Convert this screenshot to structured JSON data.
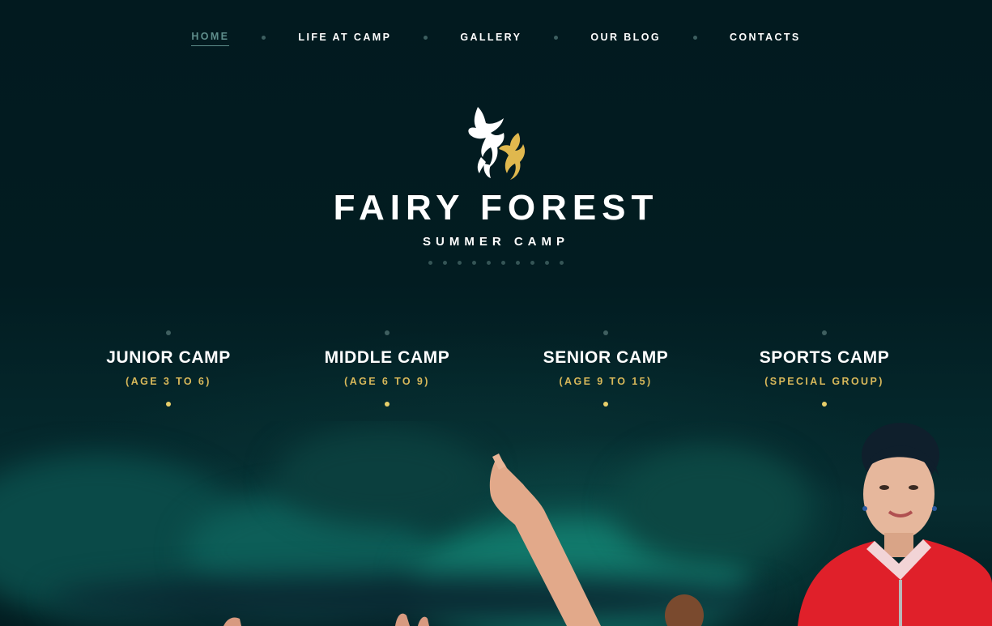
{
  "nav": {
    "items": [
      {
        "label": "HOME",
        "active": true
      },
      {
        "label": "LIFE AT CAMP",
        "active": false
      },
      {
        "label": "GALLERY",
        "active": false
      },
      {
        "label": "OUR BLOG",
        "active": false
      },
      {
        "label": "CONTACTS",
        "active": false
      }
    ]
  },
  "brand": {
    "title": "FAIRY FOREST",
    "subtitle": "SUMMER CAMP",
    "logo_icon": "phoenix-birds-icon"
  },
  "camps": [
    {
      "title": "JUNIOR CAMP",
      "age": "(AGE 3 TO 6)"
    },
    {
      "title": "MIDDLE CAMP",
      "age": "(AGE 6 TO 9)"
    },
    {
      "title": "SENIOR CAMP",
      "age": "(AGE 9 TO 15)"
    },
    {
      "title": "SPORTS CAMP",
      "age": "(SPECIAL GROUP)"
    }
  ],
  "colors": {
    "background": "#021a1f",
    "accent_gold": "#d8b85a",
    "nav_active": "#5f8e8c",
    "text": "#ffffff"
  }
}
